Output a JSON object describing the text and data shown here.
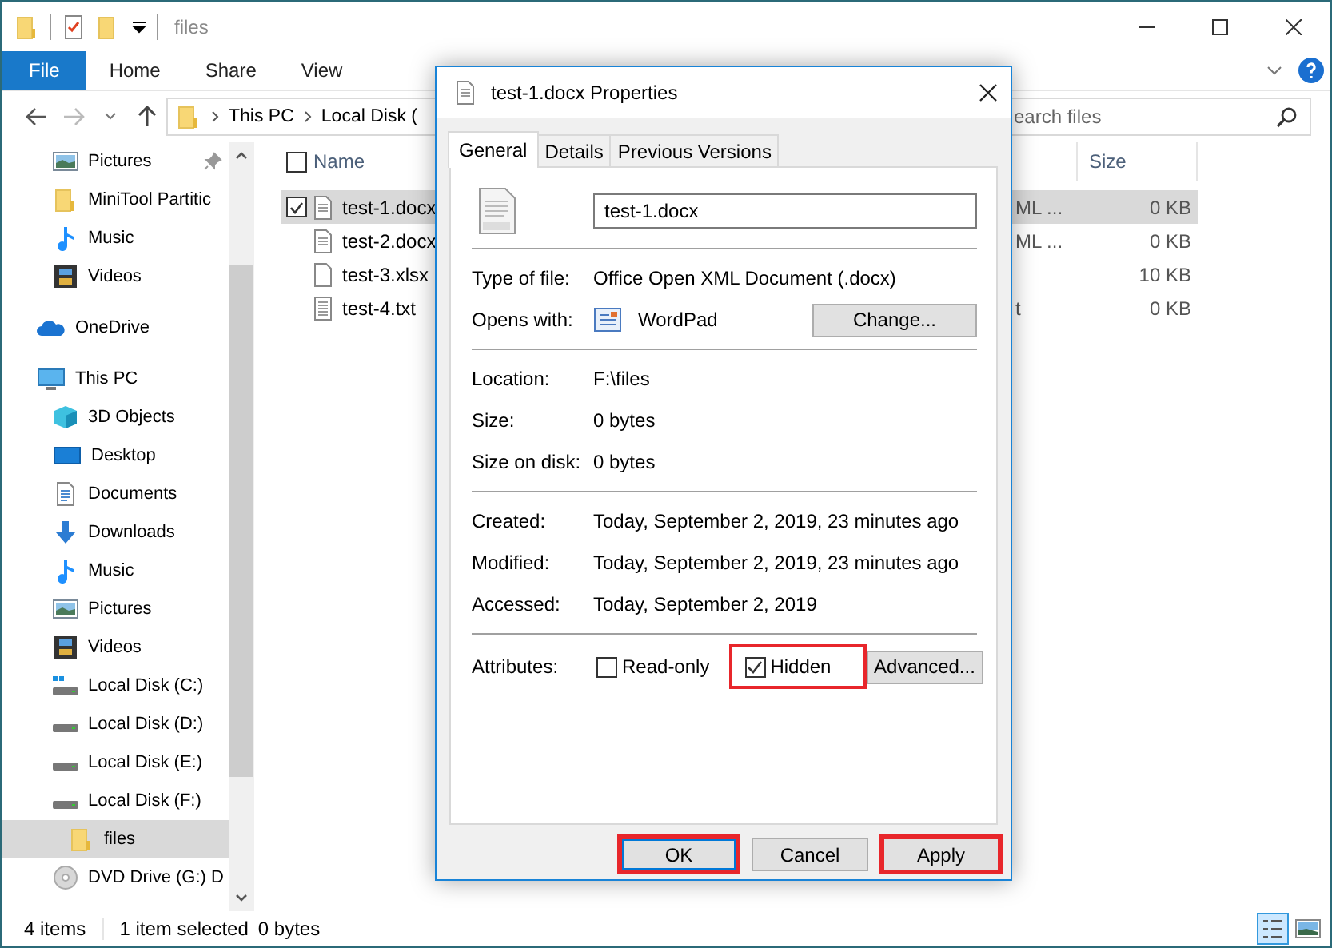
{
  "window": {
    "title": "files"
  },
  "ribbon": [
    {
      "label": "File",
      "kind": "file"
    },
    {
      "label": "Home",
      "kind": "tab"
    },
    {
      "label": "Share",
      "kind": "tab"
    },
    {
      "label": "View",
      "kind": "tab"
    }
  ],
  "address": {
    "path": [
      "This PC",
      "Local Disk ("
    ]
  },
  "search": {
    "placeholder": "earch files"
  },
  "quick_access": [
    {
      "label": "Pictures",
      "kind": "pictures",
      "pinned": true,
      "selected": false
    },
    {
      "label": "MiniTool Partitic",
      "kind": "folder",
      "pinned": false,
      "selected": false
    },
    {
      "label": "Music",
      "kind": "music",
      "pinned": false,
      "selected": false
    },
    {
      "label": "Videos",
      "kind": "videos",
      "pinned": false,
      "selected": false
    }
  ],
  "tree": [
    {
      "label": "OneDrive",
      "kind": "onedrive",
      "selected": false
    },
    {
      "label": "This PC",
      "kind": "pc",
      "selected": false,
      "children": [
        {
          "label": "3D Objects",
          "kind": "objects3d",
          "selected": false
        },
        {
          "label": "Desktop",
          "kind": "desktop",
          "selected": false
        },
        {
          "label": "Documents",
          "kind": "documents",
          "selected": false
        },
        {
          "label": "Downloads",
          "kind": "downloads",
          "selected": false
        },
        {
          "label": "Music",
          "kind": "music",
          "selected": false
        },
        {
          "label": "Pictures",
          "kind": "pictures",
          "selected": false
        },
        {
          "label": "Videos",
          "kind": "videos",
          "selected": false
        },
        {
          "label": "Local Disk (C:)",
          "kind": "system_disk",
          "selected": false
        },
        {
          "label": "Local Disk (D:)",
          "kind": "disk",
          "selected": false
        },
        {
          "label": "Local Disk (E:)",
          "kind": "disk",
          "selected": false
        },
        {
          "label": "Local Disk (F:)",
          "kind": "disk",
          "selected": false,
          "children": [
            {
              "label": "files",
              "kind": "folder",
              "selected": true
            }
          ]
        },
        {
          "label": "DVD Drive (G:) D",
          "kind": "dvd",
          "selected": false
        }
      ]
    }
  ],
  "columns": {
    "name": "Name",
    "size": "Size"
  },
  "select_all_checked": false,
  "files": [
    {
      "name": "test-1.docx",
      "kind": "doc",
      "column_3": "ML ...",
      "size": "0 KB",
      "selected": true,
      "checked": true
    },
    {
      "name": "test-2.docx",
      "kind": "doc",
      "column_3": "ML ...",
      "size": "0 KB",
      "selected": false,
      "checked": false
    },
    {
      "name": "test-3.xlsx",
      "kind": "blank",
      "size": "10 KB",
      "selected": false,
      "checked": false
    },
    {
      "name": "test-4.txt",
      "kind": "txt",
      "column_3": "t",
      "size": "0 KB",
      "selected": false,
      "checked": false
    }
  ],
  "status": {
    "count": "4 items",
    "selection": "1 item selected",
    "size": "0 bytes"
  },
  "views": [
    {
      "kind": "details",
      "selected": true
    },
    {
      "kind": "thumbnails",
      "selected": false
    }
  ],
  "dialog": {
    "title": "test-1.docx Properties",
    "tabs": [
      {
        "label": "General",
        "selected": true
      },
      {
        "label": "Details",
        "selected": false
      },
      {
        "label": "Previous Versions",
        "selected": false
      }
    ],
    "file_name": "test-1.docx",
    "sections": [
      [
        {
          "label": "Type of file:",
          "value": "Office Open XML Document (.docx)",
          "kind": "text"
        },
        {
          "label": "Opens with:",
          "value": "WordPad",
          "kind": "app",
          "button": "Change..."
        }
      ],
      [
        {
          "label": "Location:",
          "value": "F:\\files",
          "kind": "text"
        },
        {
          "label": "Size:",
          "value": "0 bytes",
          "kind": "text"
        },
        {
          "label": "Size on disk:",
          "value": "0 bytes",
          "kind": "text"
        }
      ],
      [
        {
          "label": "Created:",
          "value": "Today, September 2, 2019, 23 minutes ago",
          "kind": "text"
        },
        {
          "label": "Modified:",
          "value": "Today, September 2, 2019, 23 minutes ago",
          "kind": "text"
        },
        {
          "label": "Accessed:",
          "value": "Today, September 2, 2019",
          "kind": "text"
        }
      ]
    ],
    "attributes": {
      "label": "Attributes:",
      "checkboxes": [
        {
          "label": "Read-only",
          "checked": false,
          "highlighted": false
        },
        {
          "label": "Hidden",
          "checked": true,
          "highlighted": true
        }
      ],
      "button": "Advanced..."
    },
    "buttons": [
      {
        "label": "OK",
        "default": true,
        "highlighted": true
      },
      {
        "label": "Cancel",
        "default": false,
        "highlighted": false
      },
      {
        "label": "Apply",
        "default": false,
        "highlighted": true
      }
    ]
  }
}
